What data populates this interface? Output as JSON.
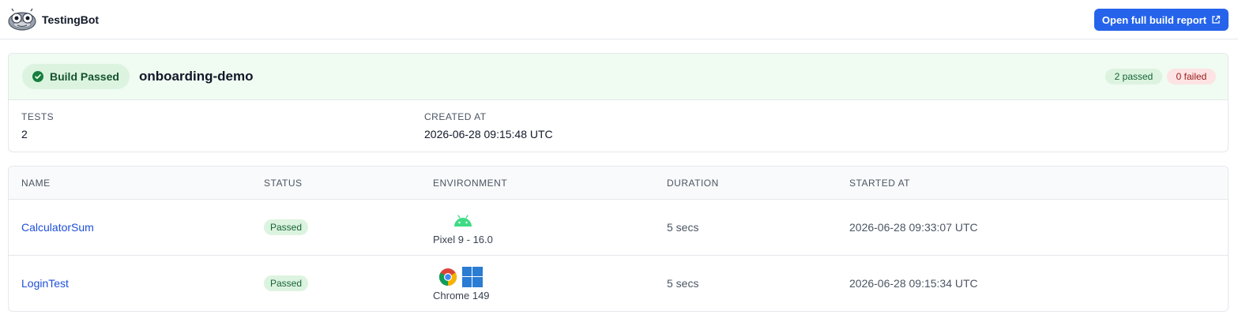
{
  "header": {
    "app_name": "TestingBot",
    "logo_icon": "robot-logo-icon",
    "report_button_label": "Open full build report",
    "accent_color": "#2563eb"
  },
  "build": {
    "status_label": "Build Passed",
    "name": "onboarding-demo",
    "passed_count_label": "2 passed",
    "failed_count_label": "0 failed",
    "meta": {
      "tests_label": "TESTS",
      "tests_value": "2",
      "created_label": "CREATED AT",
      "created_value": "2026-06-28 09:15:48 UTC"
    }
  },
  "table": {
    "columns": [
      "NAME",
      "STATUS",
      "ENVIRONMENT",
      "DURATION",
      "STARTED AT"
    ],
    "rows": [
      {
        "name": "CalculatorSum",
        "status": "Passed",
        "environment": "Pixel 9 - 16.0",
        "env_icons": [
          "android-icon"
        ],
        "duration": "5 secs",
        "started_at": "2026-06-28 09:33:07 UTC"
      },
      {
        "name": "LoginTest",
        "status": "Passed",
        "environment": "Chrome 149",
        "env_icons": [
          "chrome-icon",
          "windows-icon"
        ],
        "duration": "5 secs",
        "started_at": "2026-06-28 09:15:34 UTC"
      }
    ]
  },
  "colors": {
    "passed_bg": "#dcf3e0",
    "passed_text": "#166534",
    "failed_bg": "#fde3e3",
    "failed_text": "#991b1b",
    "link": "#1d4ed8"
  }
}
